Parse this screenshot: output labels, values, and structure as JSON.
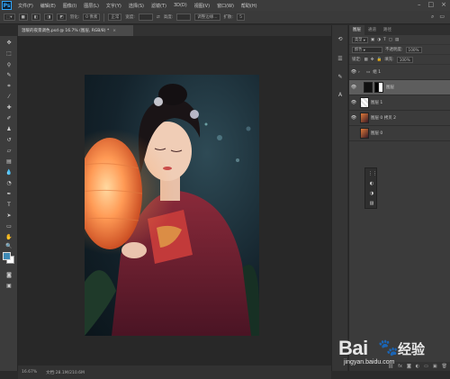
{
  "app": {
    "logo": "Ps",
    "menu": [
      "文件(F)",
      "编辑(E)",
      "图像(I)",
      "图层(L)",
      "文字(Y)",
      "选择(S)",
      "滤镜(T)",
      "3D(D)",
      "视图(V)",
      "窗口(W)",
      "帮助(H)"
    ]
  },
  "options_bar": {
    "feather_label": "羽化:",
    "feather_value": "0 像素",
    "style_value": "正常",
    "width_label": "宽度:",
    "height_label": "高度:",
    "refine_edge": "调整边缘...",
    "tolerance_label": "扩散:",
    "tolerance_value": "5"
  },
  "document": {
    "tab_title": "温暖的夜景调色.psd @ 16.7% (图层, RGB/8) *",
    "close": "×",
    "zoom": "16.67%",
    "doc_size": "文档:28.1M/210.6M"
  },
  "colors": {
    "foreground": "#3f8ab5",
    "background": "#ffffff",
    "ui_dark": "#2b2b2b"
  },
  "layers_panel": {
    "tabs": [
      "图层",
      "通道",
      "路径"
    ],
    "kind_label": "类型",
    "blend_mode": "颜色",
    "opacity_label": "不透明度:",
    "opacity_value": "100%",
    "lock_label": "锁定:",
    "fill_label": "填充:",
    "fill_value": "100%",
    "layers": [
      {
        "name": "组 1",
        "type": "group",
        "visible": true
      },
      {
        "name": "图层",
        "type": "layer-mask",
        "visible": true,
        "selected": true
      },
      {
        "name": "图层 1",
        "type": "layer",
        "visible": true
      },
      {
        "name": "图层 0 拷贝 2",
        "type": "layer",
        "visible": true
      },
      {
        "name": "图层 0",
        "type": "layer",
        "visible": true
      }
    ]
  },
  "watermark": {
    "brand": "Bai",
    "brand_cn": "经验",
    "url": "jingyan.baidu.com"
  }
}
